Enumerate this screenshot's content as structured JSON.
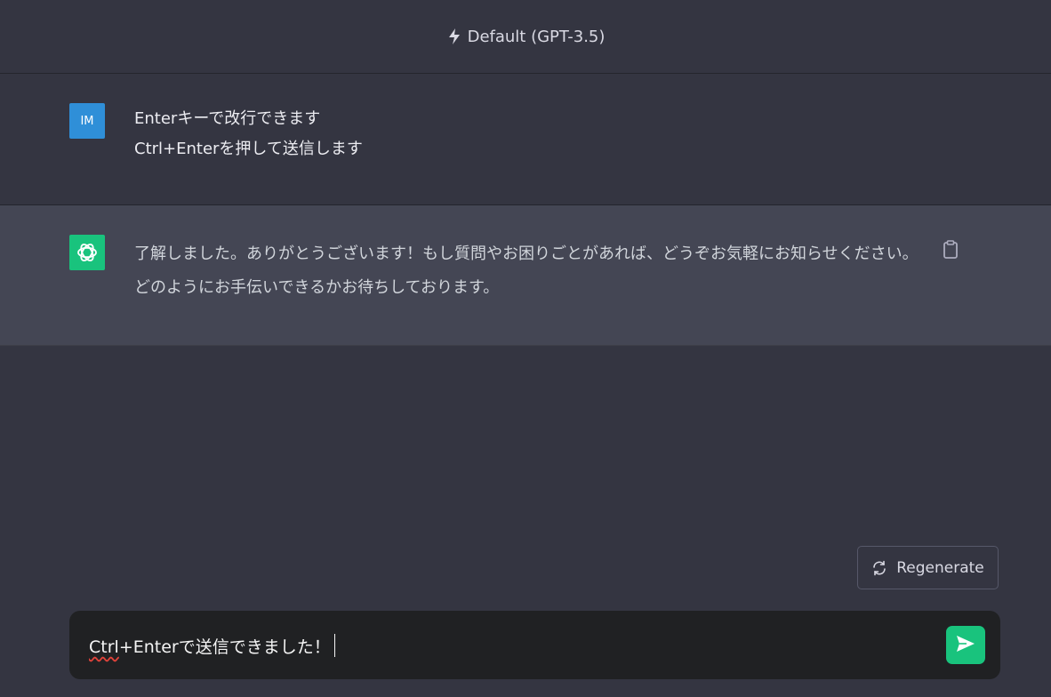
{
  "header": {
    "model_label": "Default (GPT-3.5)",
    "icon": "bolt-icon"
  },
  "user_message": {
    "avatar_initials": "IM",
    "lines": [
      "Enterキーで改行できます",
      "Ctrl+Enterを押して送信します"
    ]
  },
  "assistant_message": {
    "avatar_icon": "openai-logo-icon",
    "text": "了解しました。ありがとうございます！もし質問やお困りごとがあれば、どうぞお気軽にお知らせください。どのようにお手伝いできるかお待ちしております。",
    "copy_icon": "clipboard-icon"
  },
  "regenerate": {
    "label": "Regenerate",
    "icon": "refresh-icon"
  },
  "composer": {
    "value_prefix": "Ctrl",
    "value_rest": "+Enterで送信できました！",
    "send_icon": "send-icon"
  },
  "colors": {
    "background": "#343541",
    "assistant_bg": "#444654",
    "accent_green": "#19c37d",
    "user_avatar": "#2f8fd8",
    "composer_bg": "#202123"
  }
}
